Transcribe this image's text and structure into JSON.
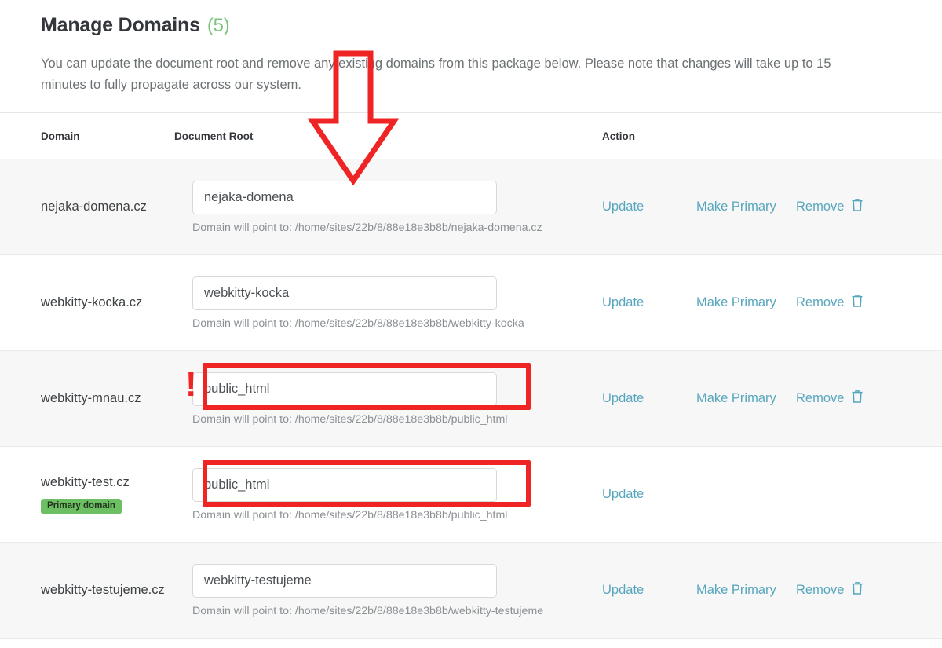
{
  "header": {
    "title": "Manage Domains",
    "count": "(5)",
    "intro": "You can update the document root and remove any existing domains from this package below. Please note that changes will take up to 15 minutes to fully propagate across our system."
  },
  "table": {
    "columns": {
      "domain": "Domain",
      "document_root": "Document Root",
      "action": "Action"
    },
    "rows": [
      {
        "domain": "nejaka-domena.cz",
        "badge": "",
        "docroot_value": "nejaka-domena",
        "hint": "Domain will point to: /home/sites/22b/8/88e18e3b8b/nejaka-domena.cz",
        "update_label": "Update",
        "make_primary_label": "Make Primary",
        "remove_label": "Remove",
        "has_make_primary": true,
        "has_remove": true
      },
      {
        "domain": "webkitty-kocka.cz",
        "badge": "",
        "docroot_value": "webkitty-kocka",
        "hint": "Domain will point to: /home/sites/22b/8/88e18e3b8b/webkitty-kocka",
        "update_label": "Update",
        "make_primary_label": "Make Primary",
        "remove_label": "Remove",
        "has_make_primary": true,
        "has_remove": true
      },
      {
        "domain": "webkitty-mnau.cz",
        "badge": "",
        "docroot_value": "public_html",
        "hint": "Domain will point to: /home/sites/22b/8/88e18e3b8b/public_html",
        "update_label": "Update",
        "make_primary_label": "Make Primary",
        "remove_label": "Remove",
        "has_make_primary": true,
        "has_remove": true
      },
      {
        "domain": "webkitty-test.cz",
        "badge": "Primary domain",
        "docroot_value": "public_html",
        "hint": "Domain will point to: /home/sites/22b/8/88e18e3b8b/public_html",
        "update_label": "Update",
        "make_primary_label": "",
        "remove_label": "",
        "has_make_primary": false,
        "has_remove": false
      },
      {
        "domain": "webkitty-testujeme.cz",
        "badge": "",
        "docroot_value": "webkitty-testujeme",
        "hint": "Domain will point to: /home/sites/22b/8/88e18e3b8b/webkitty-testujeme",
        "update_label": "Update",
        "make_primary_label": "Make Primary",
        "remove_label": "Remove",
        "has_make_primary": true,
        "has_remove": true
      }
    ]
  },
  "annotations": {
    "arrow_color": "#ee2524",
    "highlight_color": "#ee2524",
    "exclamation": "!"
  },
  "colors": {
    "accent_link": "#57a6bd",
    "count_green": "#7ac47f",
    "badge_green": "#6cbf63",
    "annotation_red": "#ee2524",
    "row_stripe": "#f7f7f7"
  }
}
